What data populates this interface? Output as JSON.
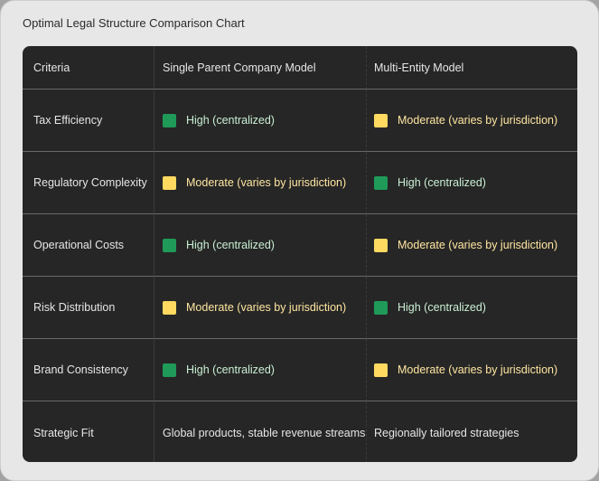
{
  "title": "Optimal Legal Structure Comparison Chart",
  "headers": [
    "Criteria",
    "Single Parent Company Model",
    "Multi-Entity Model"
  ],
  "colors": {
    "high": "#1f9a59",
    "moderate": "#ffd960"
  },
  "rows": [
    {
      "criteria": "Tax Efficiency",
      "single": {
        "level": "high",
        "text": "High (centralized)"
      },
      "multi": {
        "level": "mod",
        "text": "Moderate (varies by jurisdiction)"
      }
    },
    {
      "criteria": "Regulatory Complexity",
      "single": {
        "level": "mod",
        "text": "Moderate (varies by jurisdiction)"
      },
      "multi": {
        "level": "high",
        "text": "High (centralized)"
      }
    },
    {
      "criteria": "Operational Costs",
      "single": {
        "level": "high",
        "text": "High (centralized)"
      },
      "multi": {
        "level": "mod",
        "text": "Moderate (varies by jurisdiction)"
      }
    },
    {
      "criteria": "Risk Distribution",
      "single": {
        "level": "mod",
        "text": "Moderate (varies by jurisdiction)"
      },
      "multi": {
        "level": "high",
        "text": "High (centralized)"
      }
    },
    {
      "criteria": "Brand Consistency",
      "single": {
        "level": "high",
        "text": "High (centralized)"
      },
      "multi": {
        "level": "mod",
        "text": "Moderate (varies by jurisdiction)"
      }
    },
    {
      "criteria": "Strategic Fit",
      "single": {
        "level": null,
        "text": "Global products, stable revenue streams"
      },
      "multi": {
        "level": null,
        "text": "Regionally tailored strategies"
      }
    }
  ]
}
